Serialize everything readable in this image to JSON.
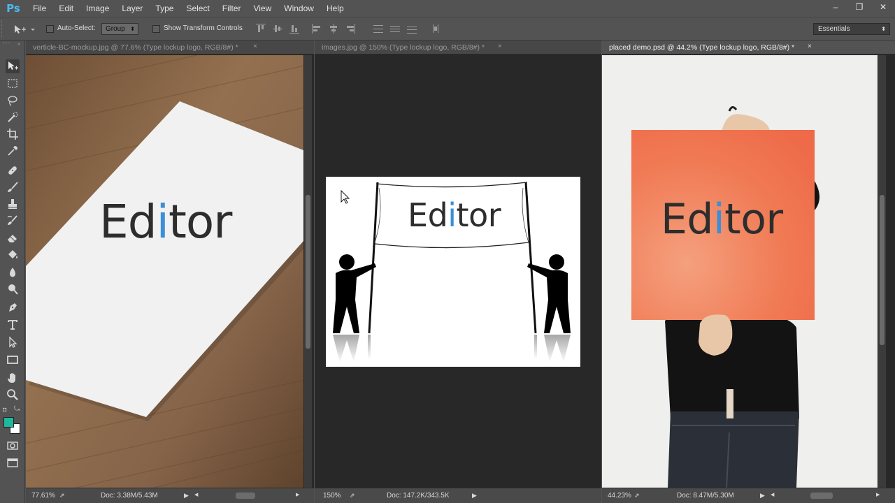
{
  "app": {
    "logo": "Ps",
    "menu": [
      "File",
      "Edit",
      "Image",
      "Layer",
      "Type",
      "Select",
      "Filter",
      "View",
      "Window",
      "Help"
    ],
    "window_controls": [
      "–",
      "❐",
      "✕"
    ]
  },
  "options_bar": {
    "auto_select_label": "Auto-Select:",
    "auto_select_value": "Group",
    "show_transform_label": "Show Transform Controls",
    "workspace": "Essentials"
  },
  "tools": [
    {
      "name": "move-tool-icon"
    },
    {
      "name": "marquee-tool-icon"
    },
    {
      "name": "lasso-tool-icon"
    },
    {
      "name": "quick-selection-tool-icon"
    },
    {
      "name": "crop-tool-icon"
    },
    {
      "name": "eyedropper-tool-icon"
    },
    {
      "name": "healing-brush-tool-icon"
    },
    {
      "name": "brush-tool-icon"
    },
    {
      "name": "clone-stamp-tool-icon"
    },
    {
      "name": "history-brush-tool-icon"
    },
    {
      "name": "eraser-tool-icon"
    },
    {
      "name": "paint-bucket-tool-icon"
    },
    {
      "name": "blur-tool-icon"
    },
    {
      "name": "dodge-tool-icon"
    },
    {
      "name": "pen-tool-icon"
    },
    {
      "name": "type-tool-icon"
    },
    {
      "name": "path-selection-tool-icon"
    },
    {
      "name": "rectangle-tool-icon"
    },
    {
      "name": "hand-tool-icon"
    },
    {
      "name": "zoom-tool-icon"
    }
  ],
  "colors": {
    "foreground": "#1fb89c",
    "background": "#ffffff",
    "logo_text": "#2d2d2d",
    "logo_accent": "#3a8fd8",
    "orange_board": "#f07a54"
  },
  "documents": [
    {
      "tab": "verticle-BC-mockup.jpg @ 77.6% (Type lockup logo, RGB/8#) *",
      "zoom": "77.61%",
      "doc_size": "Doc: 3.38M/5.43M",
      "logo": {
        "pre": "Ed",
        "accent": "i",
        "post": "tor"
      }
    },
    {
      "tab": "images.jpg @ 150% (Type lockup logo, RGB/8#) *",
      "zoom": "150%",
      "doc_size": "Doc: 147.2K/343.5K",
      "logo": {
        "pre": "Ed",
        "accent": "i",
        "post": "tor"
      }
    },
    {
      "tab": "placed demo.psd @ 44.2% (Type lockup logo, RGB/8#) *",
      "zoom": "44.23%",
      "doc_size": "Doc: 8.47M/5.30M",
      "logo": {
        "pre": "Ed",
        "accent": "i",
        "post": "tor"
      }
    }
  ],
  "close_glyph": "×"
}
